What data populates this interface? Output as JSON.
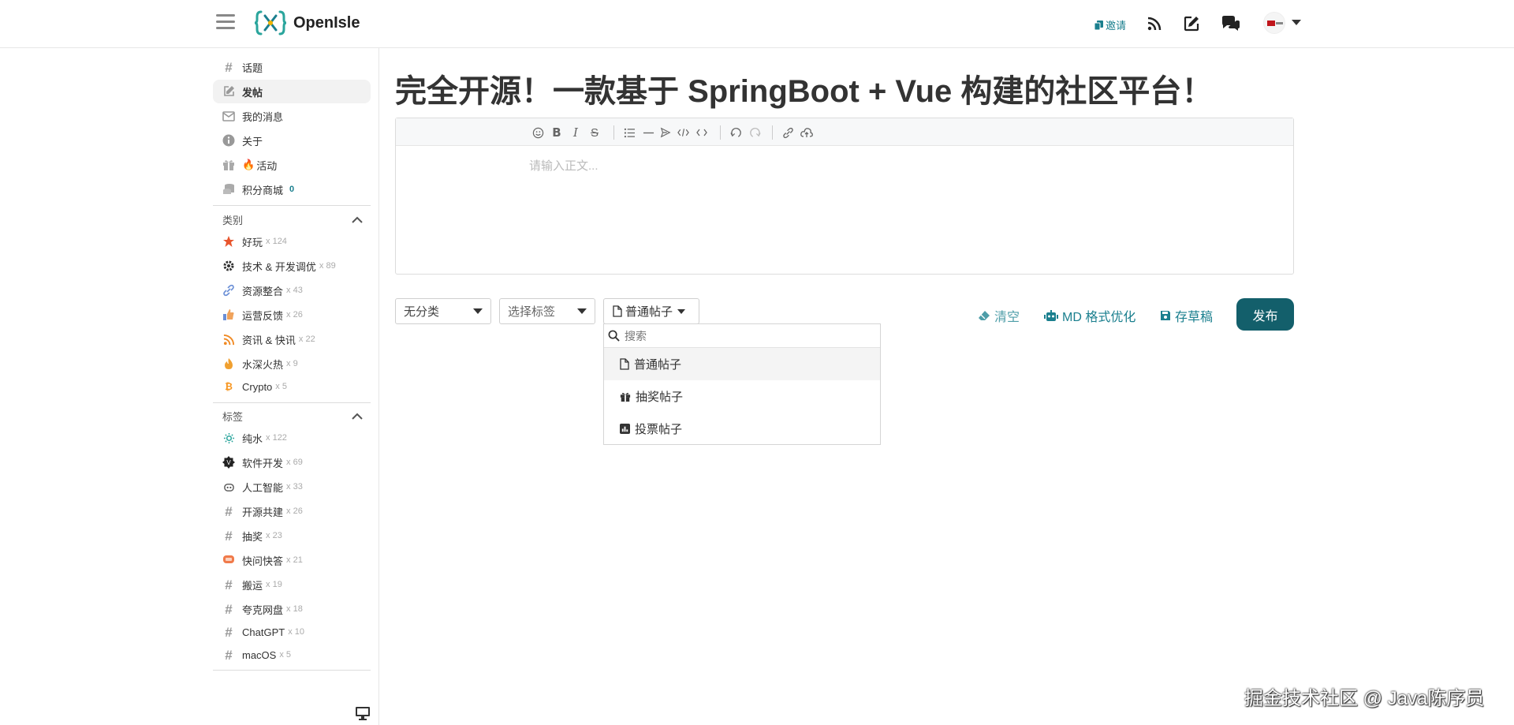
{
  "header": {
    "site_name": "OpenIsle",
    "invite_label": "邀请",
    "icons": [
      "menu-icon",
      "rss-icon",
      "edit-icon",
      "chat-icon"
    ]
  },
  "sidebar": {
    "nav": [
      {
        "label": "话题",
        "icon": "hash-icon"
      },
      {
        "label": "发帖",
        "icon": "edit-icon",
        "active": true
      },
      {
        "label": "我的消息",
        "icon": "mail-icon"
      },
      {
        "label": "关于",
        "icon": "info-icon"
      },
      {
        "label": "活动",
        "icon": "gift-icon",
        "emoji": "🔥"
      },
      {
        "label": "积分商城",
        "icon": "coins-icon",
        "badge": "0"
      }
    ],
    "categories_title": "类别",
    "categories": [
      {
        "label": "好玩",
        "count": "x 124",
        "color": "#e8552d"
      },
      {
        "label": "技术 & 开发调优",
        "count": "x 89",
        "color": "#333333"
      },
      {
        "label": "资源整合",
        "count": "x 43",
        "color": "#6b8fd6"
      },
      {
        "label": "运营反馈",
        "count": "x 26",
        "color": "#f0a35c"
      },
      {
        "label": "资讯 & 快讯",
        "count": "x 22",
        "color": "#f08a24"
      },
      {
        "label": "水深火热",
        "count": "x 9",
        "color": "#f0a030"
      },
      {
        "label": "Crypto",
        "count": "x 5",
        "color": "#f7931a"
      }
    ],
    "tags_title": "标签",
    "tags": [
      {
        "label": "纯水",
        "count": "x 122"
      },
      {
        "label": "软件开发",
        "count": "x 69"
      },
      {
        "label": "人工智能",
        "count": "x 33"
      },
      {
        "label": "开源共建",
        "count": "x 26"
      },
      {
        "label": "抽奖",
        "count": "x 23"
      },
      {
        "label": "快问快答",
        "count": "x 21"
      },
      {
        "label": "搬运",
        "count": "x 19"
      },
      {
        "label": "夸克网盘",
        "count": "x 18"
      },
      {
        "label": "ChatGPT",
        "count": "x 10"
      },
      {
        "label": "macOS",
        "count": "x 5"
      }
    ]
  },
  "main": {
    "title": "完全开源！一款基于 SpringBoot + Vue 构建的社区平台！",
    "editor_placeholder": "请输入正文...",
    "category_select": "无分类",
    "tag_select": "选择标签",
    "post_type": "普通帖子",
    "dropdown": {
      "search_placeholder": "搜索",
      "options": [
        "普通帖子",
        "抽奖帖子",
        "投票帖子"
      ]
    },
    "actions": {
      "clear": "清空",
      "md_optimize": "MD 格式优化",
      "save_draft": "存草稿",
      "publish": "发布"
    }
  },
  "watermark": "掘金技术社区 @ Java陈序员",
  "colors": {
    "accent": "#1a7f8e",
    "publish": "#135f6b"
  }
}
